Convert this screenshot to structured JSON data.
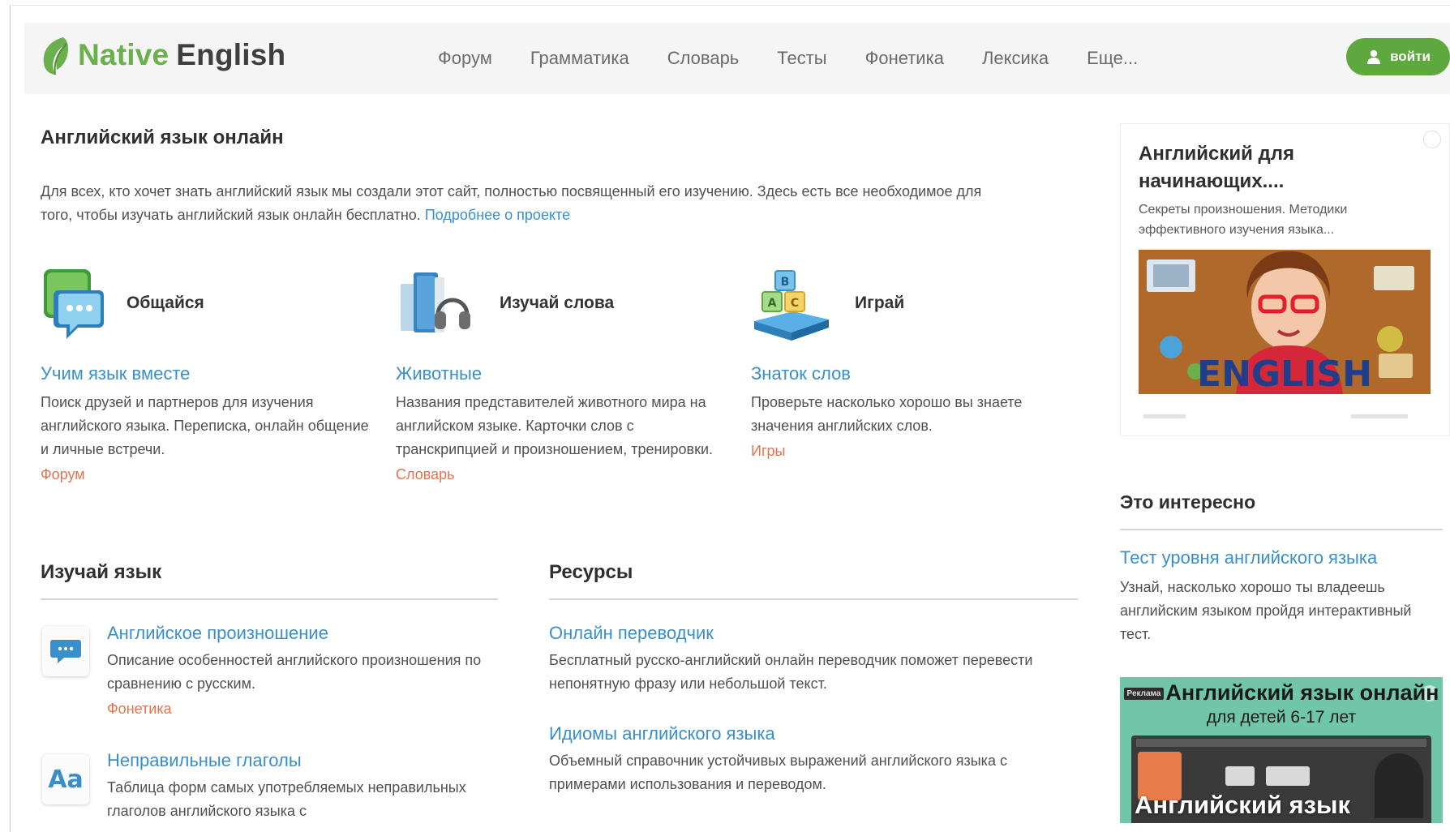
{
  "brand": {
    "name_part1": "Native",
    "name_part2": "English",
    "green": "#6ab04c",
    "link_color": "#3a8fc9",
    "tag_color": "#e3734f"
  },
  "nav": {
    "items": [
      "Форум",
      "Грамматика",
      "Словарь",
      "Тесты",
      "Фонетика",
      "Лексика",
      "Еще..."
    ],
    "login_label": "войти"
  },
  "main": {
    "title": "Английский язык онлайн",
    "intro_text": "Для всех, кто хочет знать английский язык мы создали этот сайт, полностью посвященный его изучению. Здесь есть все необходимое для того, чтобы изучать английский язык онлайн бесплатно. ",
    "intro_link": "Подробнее о проекте",
    "features": [
      {
        "title": "Общайся",
        "icon": "chat-bubbles-icon",
        "link": "Учим язык вместе",
        "desc": "Поиск друзей и партнеров для изучения английского языка. Переписка, онлайн общение и личные встречи.",
        "tag": "Форум"
      },
      {
        "title": "Изучай слова",
        "icon": "books-headphones-icon",
        "link": "Животные",
        "desc": "Названия представителей животного мира на английском языке. Карточки слов с транскрипцией и произношением, тренировки.",
        "tag": "Словарь"
      },
      {
        "title": "Играй",
        "icon": "abc-blocks-icon",
        "link": "Знаток слов",
        "desc": "Проверьте насколько хорошо вы знаете значения английских слов.",
        "tag": "Игры"
      }
    ],
    "learn": {
      "heading": "Изучай язык",
      "items": [
        {
          "title": "Английское произношение",
          "desc": "Описание особенностей английского произношения по сравнению с русским.",
          "tag": "Фонетика",
          "icon": "speech-bubble-icon"
        },
        {
          "title": "Неправильные глаголы",
          "desc": "Таблица форм самых употребляемых неправильных глаголов английского языка с",
          "icon_text": "Aa"
        }
      ]
    },
    "resources": {
      "heading": "Ресурсы",
      "items": [
        {
          "title": "Онлайн переводчик",
          "desc": "Бесплатный русско-английский онлайн переводчик поможет перевести непонятную фразу или небольшой текст."
        },
        {
          "title": "Идиомы английского языка",
          "desc": "Объемный справочник устойчивых выражений английского языка с примерами использования и переводом."
        }
      ]
    }
  },
  "sidebar": {
    "ad": {
      "title": "Английский для начинающих....",
      "subtitle": "Секреты произношения. Методики эффективного изучения языка..."
    },
    "interesting": {
      "heading": "Это интересно",
      "link": "Тест уровня английского языка",
      "desc": "Узнай, насколько хорошо ты владеешь английским языком пройдя интерактивный тест."
    },
    "promo": {
      "badge": "Реклама",
      "top_text": "Английский язык онлайн",
      "sub_text": "для детей 6-17 лет",
      "bottom_text": "Английский язык"
    }
  }
}
